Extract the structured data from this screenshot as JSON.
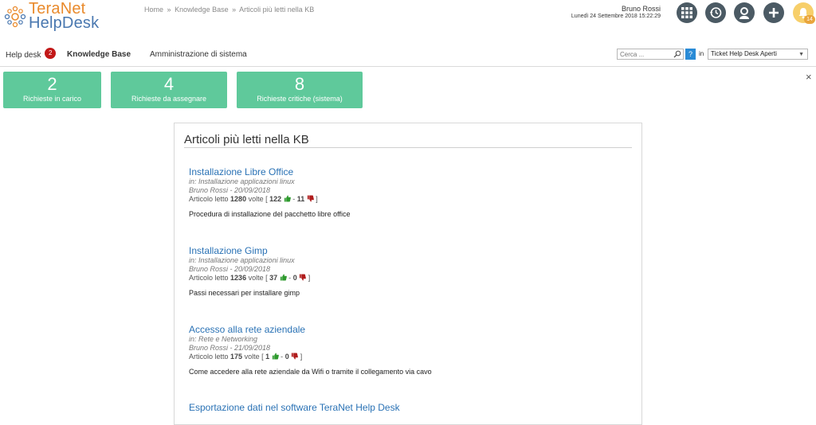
{
  "logo": {
    "line1": "TeraNet",
    "line2": "HelpDesk"
  },
  "breadcrumb": {
    "home": "Home",
    "sep1": "»",
    "kb": "Knowledge Base",
    "sep2": "»",
    "current": "Articoli più letti nella KB"
  },
  "user": {
    "name": "Bruno Rossi",
    "datetime": "Lunedì 24 Settembre 2018 15:22:29"
  },
  "header_icons": [
    {
      "icon": "apps-grid-icon"
    },
    {
      "icon": "history-icon"
    },
    {
      "icon": "user-profile-icon"
    },
    {
      "icon": "add-icon"
    },
    {
      "icon": "notifications-bell-icon",
      "count": "14"
    }
  ],
  "nav": {
    "helpdesk": "Help desk",
    "helpdesk_badge": "2",
    "kb": "Knowledge Base",
    "admin": "Amministrazione di sistema",
    "search_placeholder": "Cerca ...",
    "help": "?",
    "in_label": "in",
    "select_value": "Ticket Help Desk Aperti"
  },
  "close_label": "×",
  "tiles": [
    {
      "number": "2",
      "label": "Richieste in carico"
    },
    {
      "number": "4",
      "label": "Richieste da assegnare"
    },
    {
      "number": "8",
      "label": "Richieste critiche (sistema)"
    }
  ],
  "panel": {
    "title": "Articoli più letti nella KB",
    "articles": [
      {
        "title": "Installazione Libre Office",
        "category": "in: Installazione applicazioni linux",
        "author_date": "Bruno Rossi - 20/09/2018",
        "read_prefix": "Articolo letto",
        "reads": "1280",
        "read_suffix": "volte [",
        "likes": "122",
        "dash": "-",
        "dislikes": "11",
        "close": "]",
        "description": "Procedura di installazione del pacchetto libre office"
      },
      {
        "title": "Installazione Gimp",
        "category": "in: Installazione applicazioni linux",
        "author_date": "Bruno Rossi - 20/09/2018",
        "read_prefix": "Articolo letto",
        "reads": "1236",
        "read_suffix": "volte [",
        "likes": "37",
        "dash": "-",
        "dislikes": "0",
        "close": "]",
        "description": "Passi necessari per installare gimp"
      },
      {
        "title": "Accesso alla rete aziendale",
        "category": "in: Rete e Networking",
        "author_date": "Bruno Rossi - 21/09/2018",
        "read_prefix": "Articolo letto",
        "reads": "175",
        "read_suffix": "volte [",
        "likes": "1",
        "dash": "-",
        "dislikes": "0",
        "close": "]",
        "description": "Come accedere alla rete aziendale da Wifi o tramite il collegamento via cavo"
      },
      {
        "title": "Esportazione dati nel software TeraNet Help Desk"
      }
    ]
  },
  "colors": {
    "tile": "#5fc99b",
    "link": "#2a72b5",
    "icon_bg": "#4b5a64",
    "badge": "#c21818",
    "like": "#2e9a2e",
    "dislike": "#b01c1c"
  }
}
